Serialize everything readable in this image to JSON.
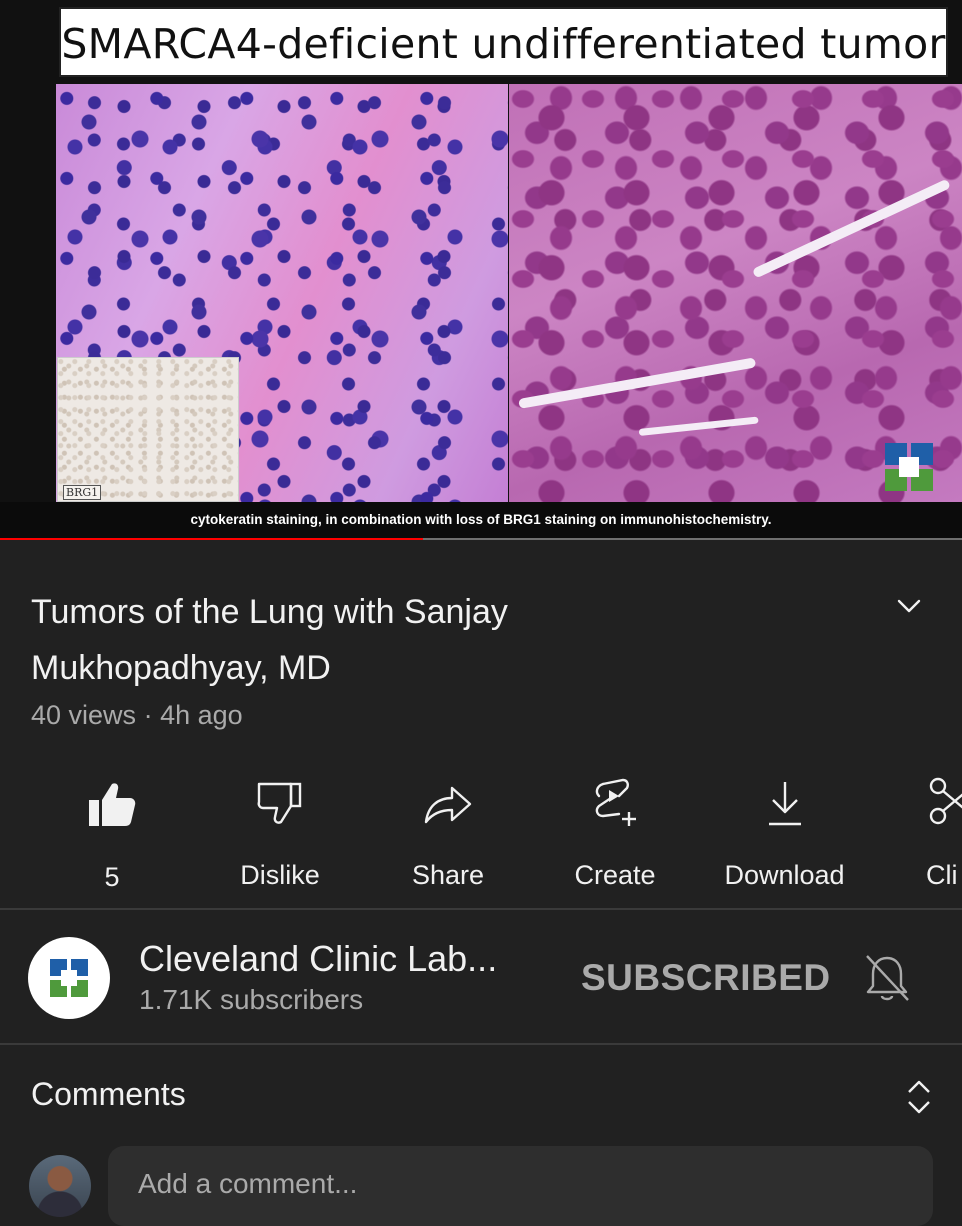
{
  "video": {
    "slide_title": "SMARCA4-deficient undifferentiated tumor",
    "inset_label": "BRG1",
    "caption": "cytokeratin staining, in combination with loss of BRG1 staining on immunohistochemistry.",
    "progress_fraction": 0.44,
    "colors": {
      "progress": "#ff0000",
      "track": "#6f6f6f"
    }
  },
  "title": {
    "line1": "Tumors of the Lung with Sanjay",
    "line2": "Mukhopadhyay, MD",
    "views": "40 views",
    "separator": "·",
    "age": "4h ago"
  },
  "actions": [
    {
      "label": "5",
      "icon": "thumbs-up-filled-icon"
    },
    {
      "label": "Dislike",
      "icon": "thumbs-down-icon"
    },
    {
      "label": "Share",
      "icon": "share-arrow-icon"
    },
    {
      "label": "Create",
      "icon": "create-remix-icon"
    },
    {
      "label": "Download",
      "icon": "download-icon"
    },
    {
      "label": "Cli",
      "icon": "clip-scissors-icon"
    }
  ],
  "channel": {
    "name": "Cleveland Clinic Lab...",
    "subscribers": "1.71K subscribers",
    "subscribe_state": "SUBSCRIBED",
    "bell_icon": "bell-off-icon"
  },
  "comments": {
    "title": "Comments",
    "placeholder": "Add a comment..."
  }
}
